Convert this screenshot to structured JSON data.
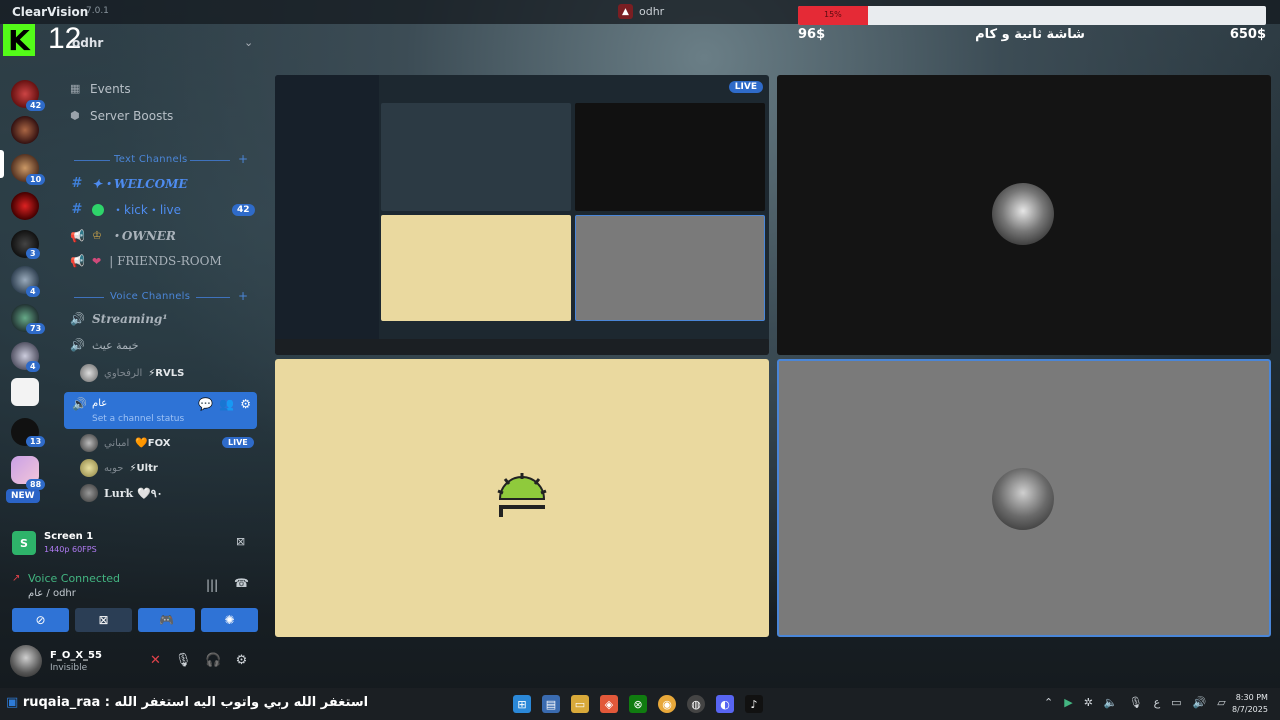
{
  "window": {
    "app_title": "ClearVision",
    "app_version": "7.0.1",
    "server_title": "odhr"
  },
  "donation": {
    "current": "96$",
    "goal_title": "شاشة ثانية و كام",
    "goal": "650$",
    "percent_label": "15%",
    "progress": 0.15
  },
  "overlay": {
    "viewer_count": "12",
    "kick_logo": "K"
  },
  "rail": {
    "badges": [
      "42",
      "10",
      "3",
      "4",
      "73",
      "4",
      "13",
      "88"
    ],
    "new_label": "NEW"
  },
  "sidebar": {
    "server_name": "odhr",
    "nav": [
      {
        "label": "Events",
        "icon": "calendar-icon"
      },
      {
        "label": "Server Boosts",
        "icon": "boost-icon"
      }
    ],
    "text_category": "Text Channels",
    "text_channels": [
      {
        "name": "✦・WELCOME",
        "badge": ""
      },
      {
        "name": "・kick・live",
        "badge": "42"
      },
      {
        "name": "・OWNER",
        "badge": ""
      },
      {
        "name": "| FRIENDS-ROOM",
        "badge": ""
      }
    ],
    "voice_category": "Voice Channels",
    "voice_channels": [
      {
        "name": "Streaming¹"
      },
      {
        "name": "خيمة عيث"
      }
    ],
    "member_rvls": {
      "ar": "الرفحاوي",
      "name": "⚡RVLS"
    },
    "active_channel": {
      "name": "عام",
      "status": "Set a channel status"
    },
    "members": [
      {
        "ar": "امباني",
        "name": "🧡FOX",
        "live": "LIVE"
      },
      {
        "ar": "حوبه",
        "name": "⚡Ultr",
        "live": ""
      },
      {
        "ar": "",
        "name": "Lurk 🤍٩٠",
        "live": ""
      }
    ]
  },
  "screen_share": {
    "title": "Screen 1",
    "quality": "1440p 60FPS"
  },
  "voice": {
    "status": "Voice Connected",
    "location": "عام / odhr"
  },
  "user": {
    "name": "F_O_X_55",
    "status": "Invisible"
  },
  "stream": {
    "live_label": "LIVE"
  },
  "taskbar": {
    "ticker_user": "ruqaia_raa :",
    "ticker_text": "استغفر الله ربي واتوب اليه استغفر الله",
    "lang": "ع",
    "time": "8:30 PM",
    "date": "8/7/2025"
  }
}
